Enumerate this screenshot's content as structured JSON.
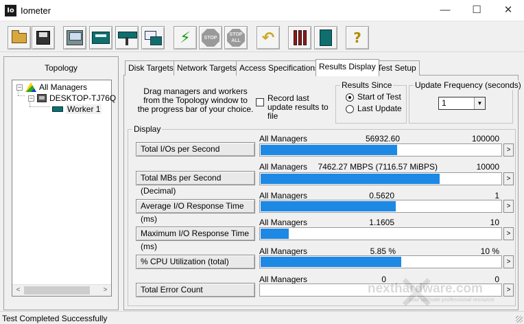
{
  "window": {
    "app_icon_text": "Io",
    "title": "Iometer",
    "min_glyph": "—",
    "max_glyph": "☐",
    "close_glyph": "✕"
  },
  "toolbar": {
    "stop_label": "STOP",
    "stop_all_label": "STOP ALL",
    "go_glyph": "⚡",
    "back_glyph": "↶",
    "help_glyph": "?"
  },
  "topology": {
    "title": "Topology",
    "tree": {
      "root_label": "All Managers",
      "root_expander": "−",
      "manager_label": "DESKTOP-TJ76Q",
      "manager_expander": "−",
      "worker_label": "Worker 1"
    },
    "scroll_left": "<",
    "scroll_right": ">"
  },
  "tabs": [
    {
      "label": "Disk Targets",
      "active": false
    },
    {
      "label": "Network Targets",
      "active": false
    },
    {
      "label": "Access Specifications",
      "active": false
    },
    {
      "label": "Results Display",
      "active": true
    },
    {
      "label": "Test Setup",
      "active": false
    }
  ],
  "results_display": {
    "drag_instruction": "Drag managers and workers from the Topology window to the progress bar of your choice.",
    "record_checkbox": {
      "label": "Record last update results to file",
      "checked": false
    },
    "results_since": {
      "title": "Results Since",
      "options": [
        {
          "label": "Start of Test",
          "selected": true
        },
        {
          "label": "Last Update",
          "selected": false
        }
      ]
    },
    "update_frequency": {
      "title": "Update Frequency (seconds)",
      "value": "1",
      "dropdown_glyph": "▼"
    },
    "display": {
      "title": "Display",
      "more_glyph": ">",
      "metrics": [
        {
          "button": "Total I/Os per Second",
          "source": "All Managers",
          "value": "56932.60",
          "max": "100000",
          "fill": 0.5693
        },
        {
          "button": "Total MBs per Second (Decimal)",
          "source": "All Managers",
          "value": "7462.27 MBPS (7116.57 MiBPS)",
          "max": "10000",
          "fill": 0.7462
        },
        {
          "button": "Average I/O Response Time (ms)",
          "source": "All Managers",
          "value": "0.5620",
          "max": "1",
          "fill": 0.562
        },
        {
          "button": "Maximum I/O Response Time (ms)",
          "source": "All Managers",
          "value": "1.1605",
          "max": "10",
          "fill": 0.1161
        },
        {
          "button": "% CPU Utilization (total)",
          "source": "All Managers",
          "value": "5.85 %",
          "max": "10 %",
          "fill": 0.585
        },
        {
          "button": "Total Error Count",
          "source": "All Managers",
          "value": "0",
          "max": "0",
          "fill": 0
        }
      ]
    }
  },
  "status": {
    "text": "Test Completed Successfully"
  },
  "watermark": {
    "name": "nexthardware.com",
    "tagline": "your ultimate professional resource"
  }
}
